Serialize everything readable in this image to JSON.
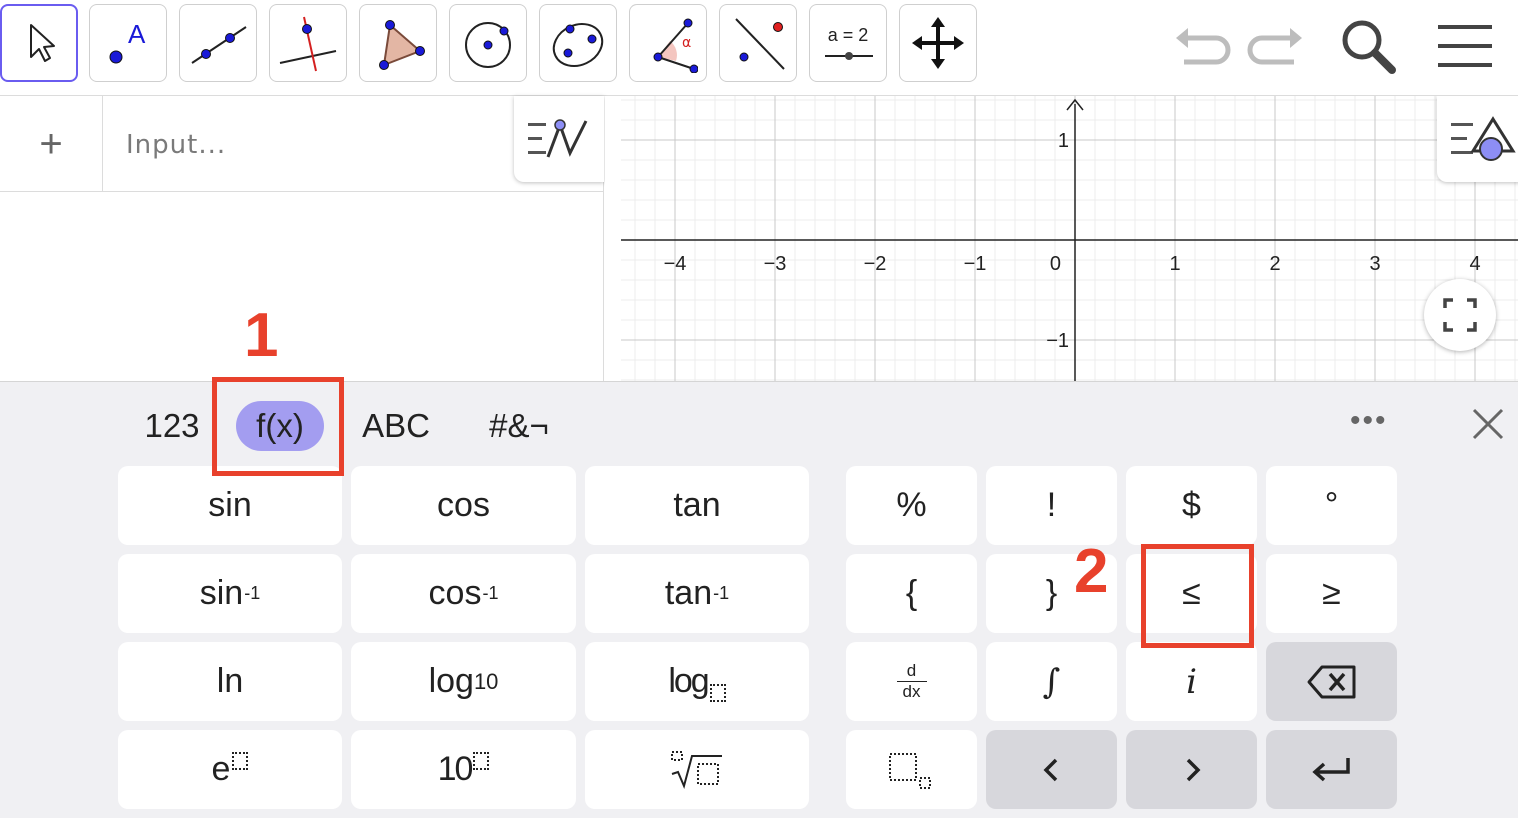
{
  "toolbar": {
    "tools": [
      {
        "name": "move-tool",
        "icon": "arrow-cursor-icon"
      },
      {
        "name": "point-tool",
        "icon": "point-label-icon",
        "label": "A"
      },
      {
        "name": "line-tool",
        "icon": "line-through-points-icon"
      },
      {
        "name": "perpendicular-line-tool",
        "icon": "perpendicular-line-icon"
      },
      {
        "name": "polygon-tool",
        "icon": "triangle-polygon-icon"
      },
      {
        "name": "circle-tool",
        "icon": "circle-center-point-icon"
      },
      {
        "name": "conic-tool",
        "icon": "ellipse-points-icon"
      },
      {
        "name": "angle-tool",
        "icon": "angle-alpha-icon",
        "label": "α"
      },
      {
        "name": "reflect-tool",
        "icon": "reflect-line-icon"
      },
      {
        "name": "slider-tool",
        "icon": "slider-icon",
        "label": "a = 2"
      },
      {
        "name": "move-graphics-tool",
        "icon": "move-arrows-icon"
      }
    ]
  },
  "algebra": {
    "input_placeholder": "Input..."
  },
  "graphics": {
    "x_ticks": [
      "−4",
      "−3",
      "−2",
      "−1",
      "0",
      "1",
      "2",
      "3",
      "4"
    ],
    "y_ticks": [
      "1",
      "−1"
    ]
  },
  "keyboard": {
    "tabs": [
      "123",
      "f(x)",
      "ABC",
      "#&¬"
    ],
    "selected_tab": "f(x)",
    "more": "•••",
    "func_keys": {
      "sin": "sin",
      "cos": "cos",
      "tan": "tan",
      "asin_base": "sin",
      "acos_base": "cos",
      "atan_base": "tan",
      "inverse_sup": "-1",
      "ln": "ln",
      "log": "log",
      "log_sub": "10",
      "logb": "log",
      "e": "e",
      "ten": "10"
    },
    "sym_keys": {
      "percent": "%",
      "factorial": "!",
      "dollar": "$",
      "degree": "°",
      "lbrace": "{",
      "rbrace": "}",
      "leq": "≤",
      "geq": "≥",
      "d": "d",
      "dx": "dx",
      "integral": "∫",
      "imag": "i",
      "left": "‹",
      "right": "›"
    }
  },
  "annotations": {
    "one": "1",
    "two": "2"
  }
}
